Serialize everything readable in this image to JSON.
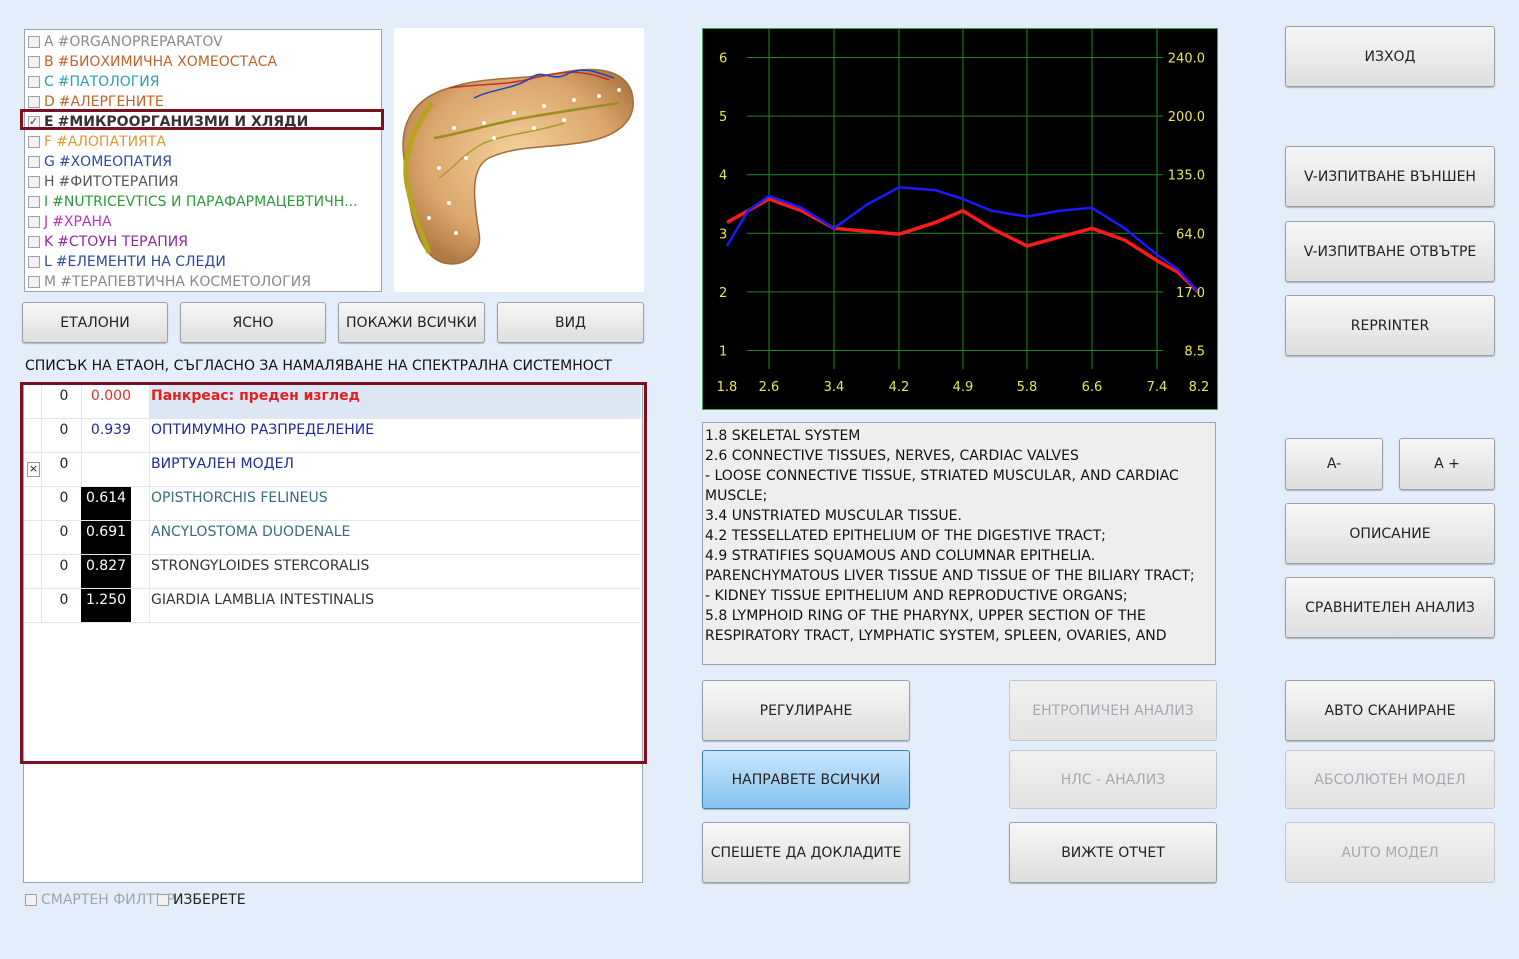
{
  "categories": [
    {
      "letter": "A",
      "label": "ORGANOPREPARATOV",
      "color": "#888888",
      "checked": false
    },
    {
      "letter": "B",
      "label": "БИОХИМИЧНА ХОМЕОСТАСА",
      "color": "#c0642a",
      "checked": false
    },
    {
      "letter": "C",
      "label": "ПАТОЛОГИЯ",
      "color": "#2a9fb0",
      "checked": false
    },
    {
      "letter": "D",
      "label": "АЛЕРГЕНИТЕ",
      "color": "#c0642a",
      "checked": false
    },
    {
      "letter": "E",
      "label": "МИКРООРГАНИЗМИ И ХЛЯДИ",
      "color": "#333333",
      "checked": true
    },
    {
      "letter": "F",
      "label": "АЛОПАТИЯТА",
      "color": "#e09a2a",
      "checked": false
    },
    {
      "letter": "G",
      "label": "ХОМЕОПАТИЯ",
      "color": "#2a4aa0",
      "checked": false
    },
    {
      "letter": "H",
      "label": "ФИТОТЕРАПИЯ",
      "color": "#555555",
      "checked": false
    },
    {
      "letter": "I",
      "label": "NUTRICEVTICS И ПАРАФАРМАЦЕВТИЧН...",
      "color": "#2a9a3a",
      "checked": false
    },
    {
      "letter": "J",
      "label": "ХРАНА",
      "color": "#c030c0",
      "checked": false
    },
    {
      "letter": "K",
      "label": "СТОУН ТЕРАПИЯ",
      "color": "#8a2aa0",
      "checked": false
    },
    {
      "letter": "L",
      "label": "ЕЛЕМЕНТИ НА СЛЕДИ",
      "color": "#2a4aa0",
      "checked": false
    },
    {
      "letter": "M",
      "label": "ТЕРАПЕВТИЧНА КОСМЕТОЛОГИЯ",
      "color": "#888888",
      "checked": false
    }
  ],
  "toolbar": {
    "etalons": "ЕТАЛОНИ",
    "clear": "ЯСНО",
    "show_all": "ПОКАЖИ ВСИЧКИ",
    "view": "ВИД"
  },
  "list_caption": "СПИСЪК НА ЕТАОН, СЪГЛАСНО ЗА НАМАЛЯВАНЕ НА СПЕКТРАЛНА СИСТЕМНОСТ",
  "results": [
    {
      "num": "0",
      "value": "0.000",
      "name": "Панкреас: преден изглед",
      "style": "header"
    },
    {
      "num": "0",
      "value": "0.939",
      "name": "ОПТИМУМНО РАЗПРЕДЕЛЕНИЕ",
      "style": "blue"
    },
    {
      "num": "0",
      "value": "",
      "name": "ВИРТУАЛЕН МОДЕЛ",
      "style": "blue",
      "mark": "×"
    },
    {
      "num": "0",
      "value": "0.614",
      "name": "OPISTHORCHIS FELINEUS",
      "style": "teal"
    },
    {
      "num": "0",
      "value": "0.691",
      "name": "ANCYLOSTOMA DUODENALE",
      "style": "teal"
    },
    {
      "num": "0",
      "value": "0.827",
      "name": "STRONGYLOIDES  STERCORALIS",
      "style": "dark"
    },
    {
      "num": "0",
      "value": "1.250",
      "name": "GIARDIA LAMBLIA INTESTINALIS",
      "style": "dark"
    }
  ],
  "bottom": {
    "smart_filter": "СМАРТЕН ФИЛТЪР",
    "select": "ИЗБЕРЕТЕ"
  },
  "chart_data": {
    "type": "line",
    "x_ticks": [
      "1.8",
      "2.6",
      "3.4",
      "4.2",
      "4.9",
      "5.8",
      "6.6",
      "7.4",
      "8.2"
    ],
    "y_left_ticks": [
      "1",
      "2",
      "3",
      "4",
      "5",
      "6"
    ],
    "y_right_ticks": [
      "8.5",
      "17.0",
      "64.0",
      "135.0",
      "200.0",
      "240.0"
    ],
    "ylim": [
      0.6,
      6.4
    ],
    "grid": true,
    "series": [
      {
        "color": "#ff1a1a",
        "x": [
          1.8,
          2.2,
          2.6,
          3.0,
          3.4,
          3.8,
          4.2,
          4.6,
          4.9,
          5.3,
          5.8,
          6.2,
          6.6,
          7.0,
          7.4,
          7.8,
          8.2
        ],
        "y": [
          3.1,
          3.3,
          3.5,
          3.3,
          3.0,
          2.95,
          2.9,
          3.1,
          3.3,
          3.0,
          2.7,
          2.85,
          3.0,
          2.8,
          2.45,
          2.25,
          1.9
        ]
      },
      {
        "color": "#1a1aff",
        "x": [
          1.8,
          2.2,
          2.6,
          3.0,
          3.4,
          3.8,
          4.2,
          4.6,
          4.9,
          5.3,
          5.8,
          6.2,
          6.6,
          7.0,
          7.4,
          7.8,
          8.2
        ],
        "y": [
          2.7,
          3.3,
          3.55,
          3.35,
          3.0,
          3.4,
          3.7,
          3.65,
          3.5,
          3.3,
          3.2,
          3.3,
          3.35,
          3.0,
          2.55,
          2.3,
          1.9
        ]
      }
    ]
  },
  "description_lines": [
    "1.8 SKELETAL SYSTEM",
    "2.6 CONNECTIVE TISSUES, NERVES, CARDIAC VALVES",
    "- LOOSE CONNECTIVE TISSUE, STRIATED MUSCULAR, AND CARDIAC MUSCLE;",
    "3.4 UNSTRIATED MUSCULAR TISSUE.",
    "4.2 TESSELLATED EPITHELIUM OF THE DIGESTIVE TRACT;",
    "4.9 STRATIFIES SQUAMOUS AND COLUMNAR EPITHELIA. PARENCHYMATOUS LIVER TISSUE AND TISSUE OF THE BILIARY TRACT;",
    "- KIDNEY TISSUE EPITHELIUM AND REPRODUCTIVE ORGANS;",
    "5.8 LYMPHOID RING OF THE PHARYNX, UPPER SECTION OF THE RESPIRATORY TRACT, LYMPHATIC SYSTEM, SPLEEN, OVARIES, AND"
  ],
  "middle_buttons": {
    "regulate": "РЕГУЛИРАНЕ",
    "entropy": "ЕНТРОПИЧЕН АНАЛИЗ",
    "do_all": "НАПРАВЕТЕ ВСИЧКИ",
    "nls": "НЛС - АНАЛИЗ",
    "save_report": "СПЕШЕТЕ ДА ДОКЛАДИТЕ",
    "view_report": "ВИЖТЕ ОТЧЕТ"
  },
  "right_buttons": {
    "exit": "ИЗХОД",
    "v_outer": "V-ИЗПИТВАНЕ ВЪНШЕН",
    "v_inner": "V-ИЗПИТВАНЕ ОТВЪТРЕ",
    "reprinter": "REPRINTER",
    "font_minus": "A-",
    "font_plus": "A +",
    "description": "ОПИСАНИЕ",
    "compare": "СРАВНИТЕЛЕН АНАЛИЗ",
    "auto_scan": "АВТО СКАНИРАНЕ",
    "absolute_model": "АБСОЛЮТЕН МОДЕЛ",
    "auto_model": "AUTO МОДЕЛ"
  }
}
